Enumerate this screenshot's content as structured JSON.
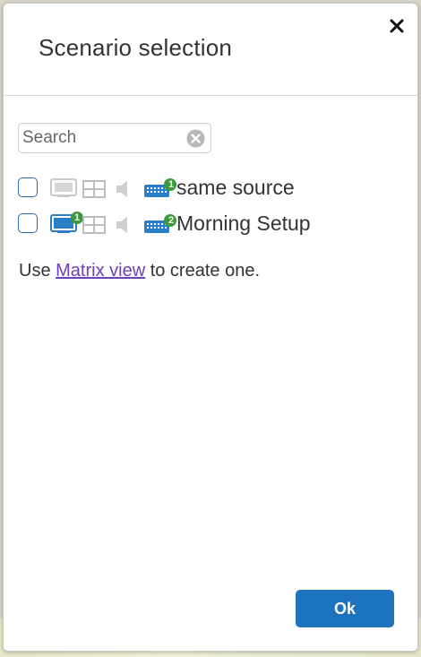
{
  "dialog": {
    "title": "Scenario selection",
    "close_icon": "close-icon"
  },
  "search": {
    "placeholder": "Search",
    "value": ""
  },
  "scenarios": [
    {
      "label": "same source",
      "checked": false,
      "display_badge": "",
      "keyboard_badge": "1",
      "display_active": false
    },
    {
      "label": "Morning Setup",
      "checked": false,
      "display_badge": "1",
      "keyboard_badge": "2",
      "display_active": true
    }
  ],
  "info": {
    "prefix": "Use ",
    "link": "Matrix view",
    "suffix": " to create one."
  },
  "footer": {
    "ok_label": "Ok"
  },
  "colors": {
    "accent": "#1e73be",
    "link": "#6f3fb8",
    "badge": "#3a9a3a",
    "inactive_icon": "#c9c9c9"
  }
}
